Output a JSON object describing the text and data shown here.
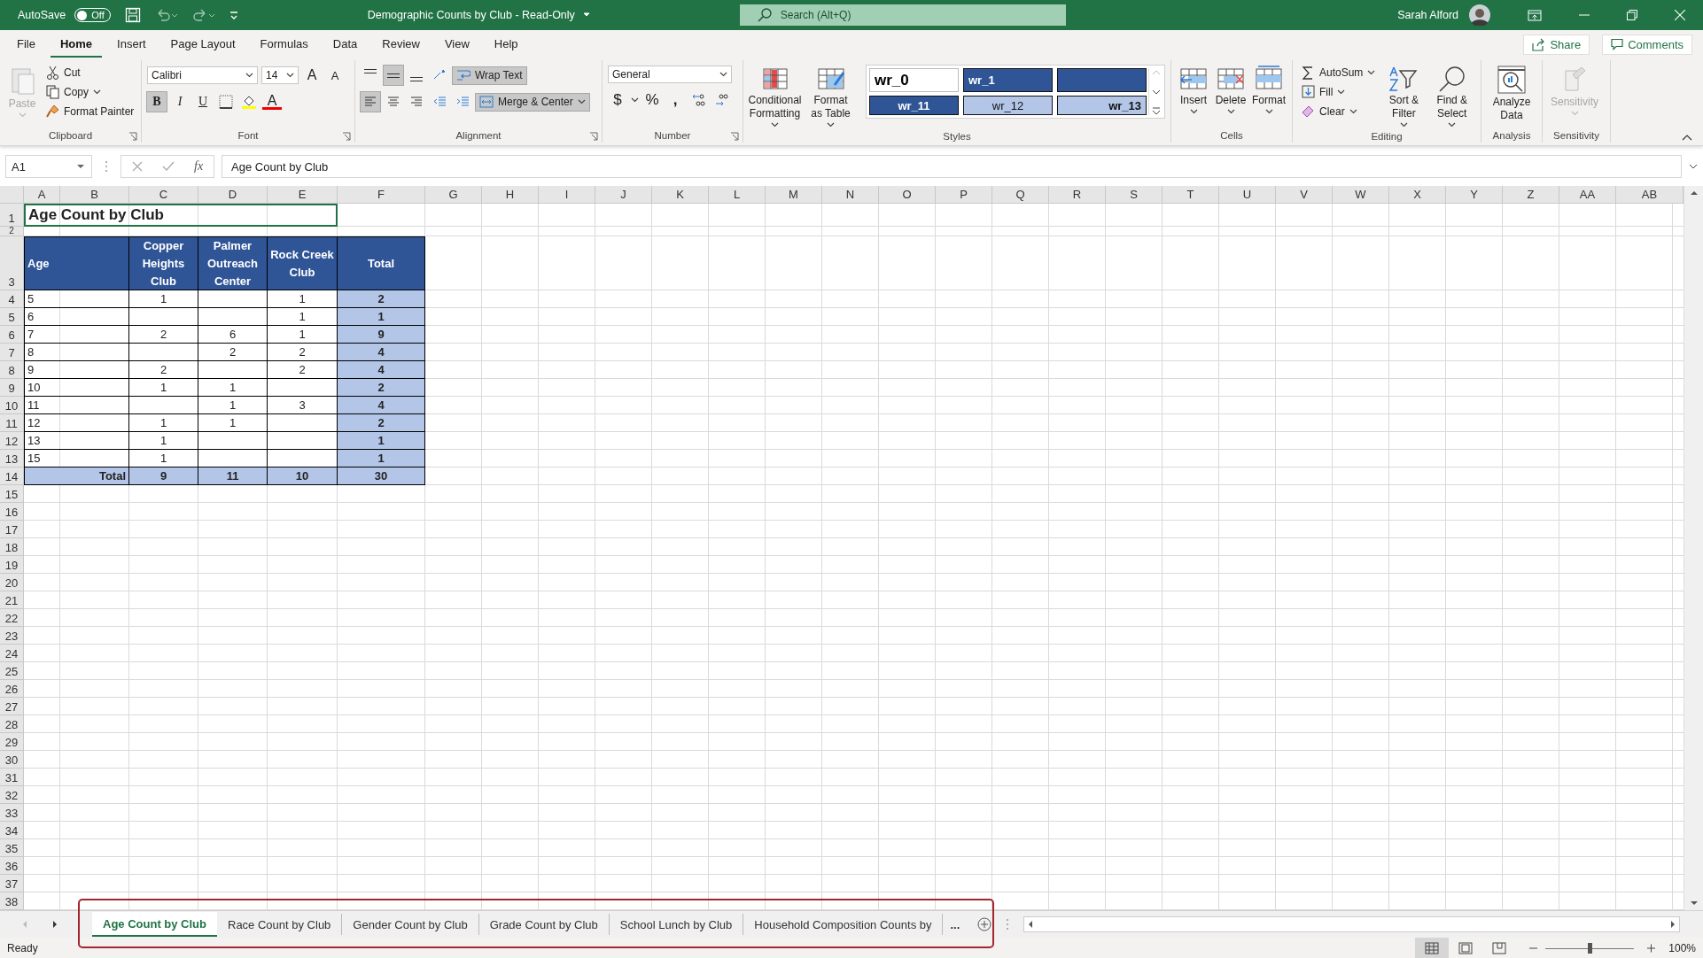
{
  "title_bar": {
    "autosave_label": "AutoSave",
    "autosave_on": false,
    "autosave_state": "Off",
    "document_title": "Demographic Counts by Club  -  Read-Only",
    "search_placeholder": "Search (Alt+Q)",
    "user_name": "Sarah Alford"
  },
  "menu_tabs": [
    {
      "label": "File",
      "selected": false
    },
    {
      "label": "Home",
      "selected": true
    },
    {
      "label": "Insert",
      "selected": false
    },
    {
      "label": "Page Layout",
      "selected": false
    },
    {
      "label": "Formulas",
      "selected": false
    },
    {
      "label": "Data",
      "selected": false
    },
    {
      "label": "Review",
      "selected": false
    },
    {
      "label": "View",
      "selected": false
    },
    {
      "label": "Help",
      "selected": false
    }
  ],
  "share_label": "Share",
  "comments_label": "Comments",
  "ribbon_groups": [
    {
      "kind": "clipboard",
      "label": "Clipboard",
      "paste": {
        "label": "Paste",
        "disabled": true
      },
      "actions": [
        {
          "label": "Cut",
          "dropdown": false
        },
        {
          "label": "Copy",
          "dropdown": true
        },
        {
          "label": "Format Painter",
          "dropdown": false
        }
      ]
    },
    {
      "kind": "font",
      "label": "Font",
      "font_name": "Calibri",
      "font_size": "14",
      "grow_font": "A",
      "shrink_font": "A",
      "toggles": [
        {
          "label": "B",
          "selected": true
        },
        {
          "label": "I",
          "selected": false
        },
        {
          "label": "U",
          "selected": false
        }
      ],
      "font_color": "A"
    },
    {
      "kind": "alignment",
      "label": "Alignment",
      "vertical": [
        {
          "selected": false
        },
        {
          "selected": true
        },
        {
          "selected": false
        }
      ],
      "horizontal": [
        {
          "selected": true
        },
        {
          "selected": false
        },
        {
          "selected": false
        }
      ],
      "wrap_text": {
        "label": "Wrap Text",
        "selected": true
      },
      "merge": {
        "label": "Merge & Center",
        "selected": true
      }
    },
    {
      "kind": "number",
      "label": "Number",
      "format": "General",
      "currency": "$",
      "percent": "%",
      "comma": ","
    },
    {
      "kind": "styles",
      "label": "Styles",
      "commands": [
        {
          "label": "Conditional Formatting"
        },
        {
          "label": "Format as Table"
        }
      ],
      "gallery": [
        {
          "label": "wr_0",
          "kind": "plain"
        },
        {
          "label": "wr_1",
          "kind": "dark"
        },
        {
          "kind": "dark"
        },
        {
          "label": "wr_11",
          "kind": "dark-center"
        },
        {
          "label": "wr_12",
          "kind": "light-center"
        },
        {
          "label": "wr_13",
          "kind": "light-right"
        }
      ]
    },
    {
      "kind": "cells",
      "label": "Cells",
      "commands": [
        {
          "label": "Insert"
        },
        {
          "label": "Delete"
        },
        {
          "label": "Format"
        }
      ]
    },
    {
      "kind": "editing",
      "label": "Editing",
      "actions": [
        {
          "label": "AutoSum"
        },
        {
          "label": "Fill"
        },
        {
          "label": "Clear"
        }
      ],
      "commands": [
        {
          "label": "Sort & Filter"
        },
        {
          "label": "Find & Select"
        }
      ]
    },
    {
      "kind": "analysis",
      "label": "Analysis",
      "commands": [
        {
          "label": "Analyze Data",
          "disabled": false
        }
      ]
    },
    {
      "kind": "sensitivity",
      "label": "Sensitivity",
      "commands": [
        {
          "label": "Sensitivity",
          "disabled": true
        }
      ]
    }
  ],
  "formula_bar": {
    "name_box": "A1",
    "function_symbol": "fx",
    "formula": "Age Count by Club"
  },
  "sheet": {
    "columns": [
      "A",
      "B",
      "C",
      "D",
      "E",
      "F",
      "G",
      "H",
      "I",
      "J",
      "K",
      "L",
      "M",
      "N",
      "O",
      "P",
      "Q",
      "R",
      "S",
      "T",
      "U",
      "V",
      "W",
      "X",
      "Y",
      "Z",
      "AA",
      "AB"
    ],
    "rows": [
      "1",
      "2",
      "3",
      "4",
      "5",
      "6",
      "7",
      "8",
      "9",
      "10",
      "11",
      "12",
      "13",
      "14",
      "15",
      "16",
      "17",
      "18",
      "19",
      "20",
      "21",
      "22",
      "23",
      "24",
      "25",
      "26",
      "27",
      "28",
      "29",
      "30",
      "31",
      "32",
      "33",
      "34",
      "35",
      "36",
      "37",
      "38"
    ],
    "title": {
      "text": "Age Count by Club",
      "selected": true
    },
    "table": {
      "header": [
        "Age",
        "Copper Heights Club",
        "Palmer Outreach Center",
        "Rock Creek Club",
        "Total"
      ],
      "rows": [
        {
          "age": "5",
          "copper": "1",
          "rock_creek": "1",
          "total": "2"
        },
        {
          "age": "6",
          "rock_creek": "1",
          "total": "1"
        },
        {
          "age": "7",
          "copper": "2",
          "palmer": "6",
          "rock_creek": "1",
          "total": "9"
        },
        {
          "age": "8",
          "palmer": "2",
          "rock_creek": "2",
          "total": "4"
        },
        {
          "age": "9",
          "copper": "2",
          "rock_creek": "2",
          "total": "4"
        },
        {
          "age": "10",
          "copper": "1",
          "palmer": "1",
          "total": "2"
        },
        {
          "age": "11",
          "palmer": "1",
          "rock_creek": "3",
          "total": "4"
        },
        {
          "age": "12",
          "copper": "1",
          "palmer": "1",
          "total": "2"
        },
        {
          "age": "13",
          "copper": "1",
          "total": "1"
        },
        {
          "age": "15",
          "copper": "1",
          "total": "1"
        }
      ],
      "footer": {
        "label": "Total",
        "copper": "9",
        "palmer": "11",
        "rock_creek": "10",
        "total": "30"
      }
    }
  },
  "sheet_tabs": [
    {
      "label": "Age Count by Club",
      "selected": true
    },
    {
      "label": "Race Count by Club",
      "selected": false
    },
    {
      "label": "Gender Count by Club",
      "selected": false
    },
    {
      "label": "Grade Count by Club",
      "selected": false
    },
    {
      "label": "School Lunch by Club",
      "selected": false
    },
    {
      "label": "Household Composition Counts by",
      "selected": false
    }
  ],
  "more_tabs": "...",
  "status_bar": {
    "status": "Ready",
    "views": [
      {
        "selected": true
      },
      {
        "selected": false
      },
      {
        "selected": false
      }
    ],
    "zoom": {
      "level": 0.5
    },
    "zoom_label": "100%"
  }
}
